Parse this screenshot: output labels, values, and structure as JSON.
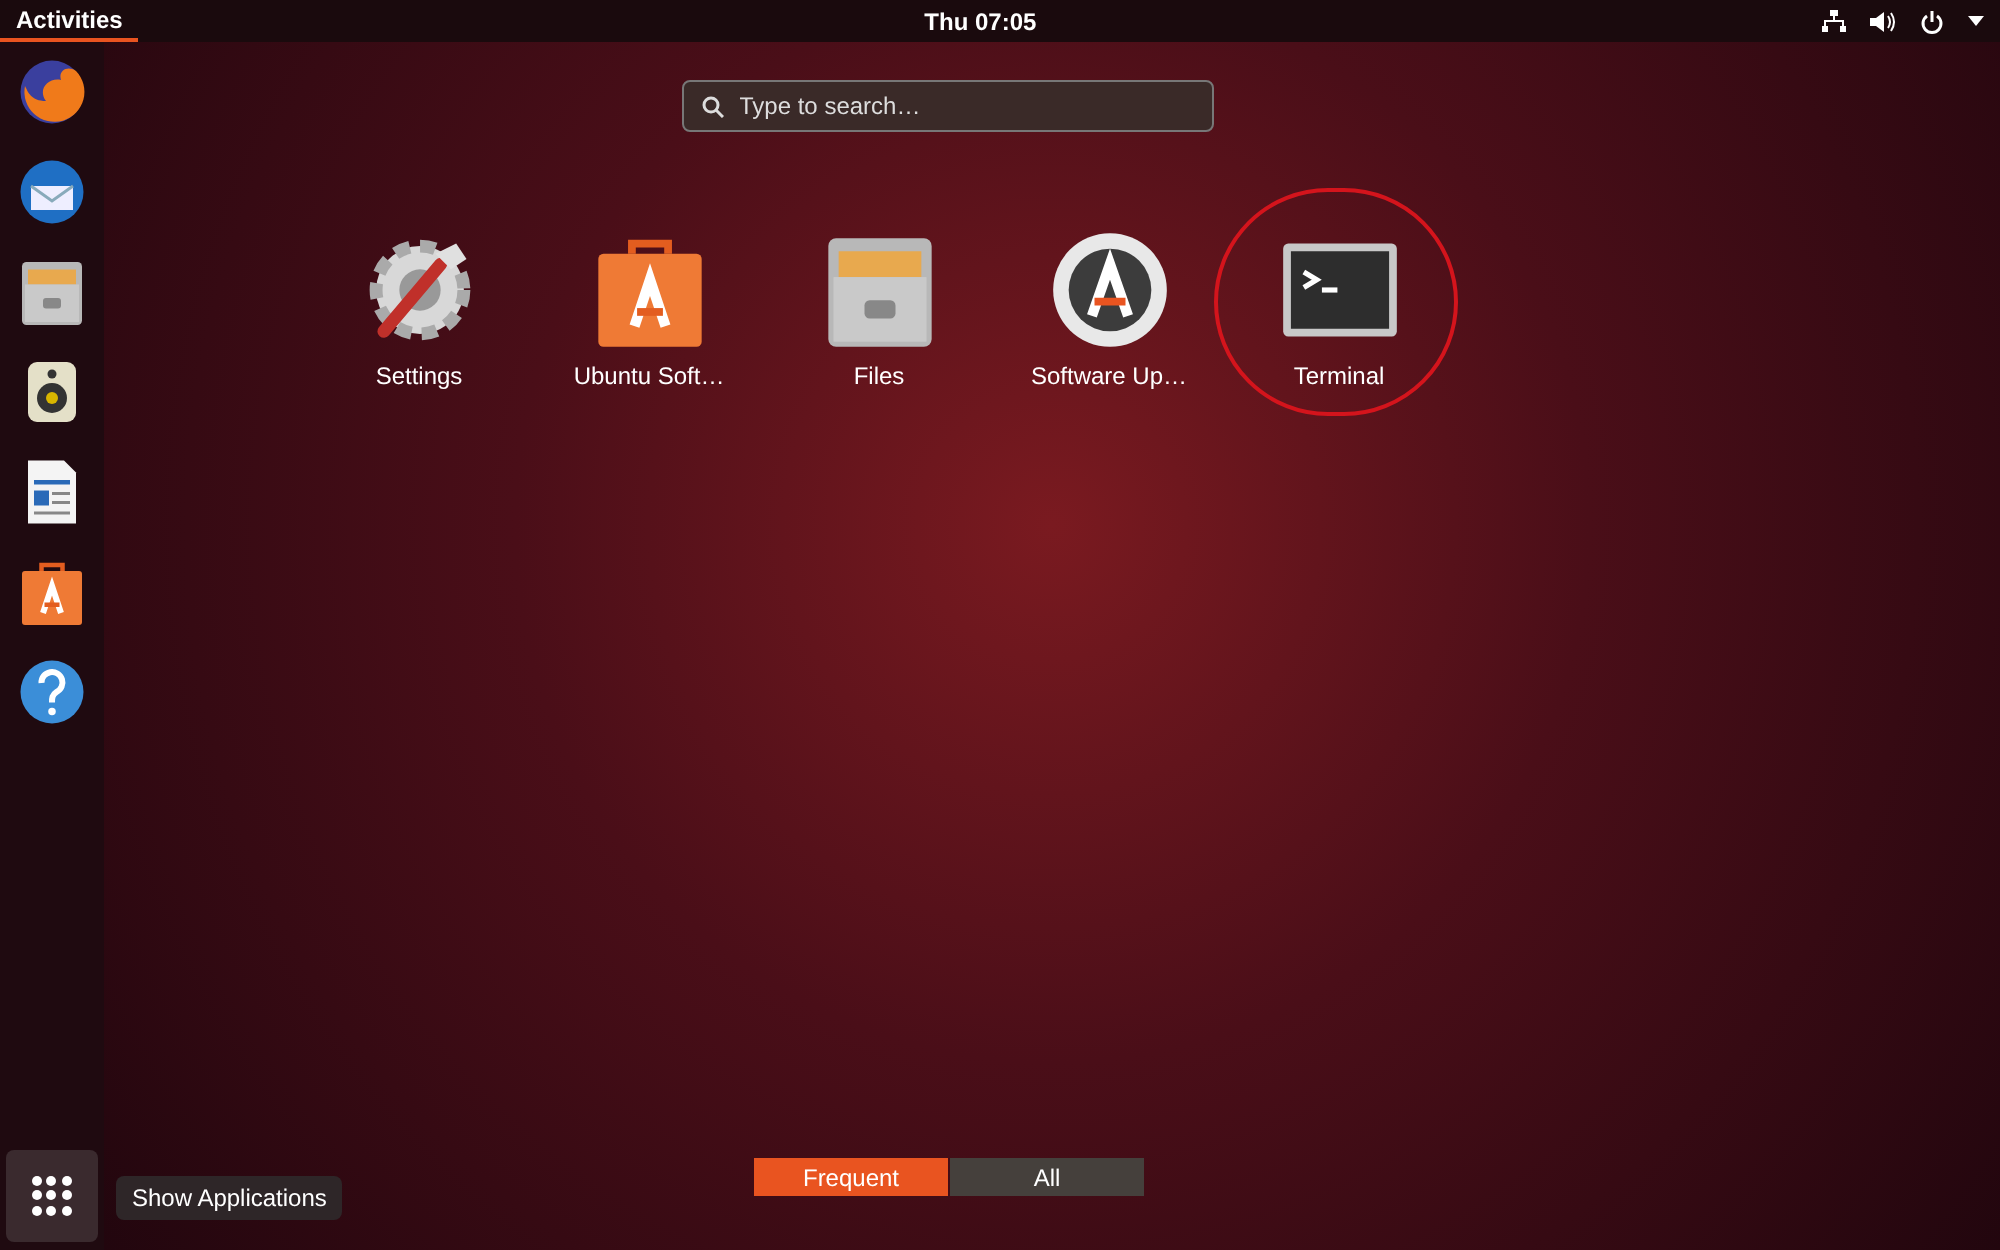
{
  "top_bar": {
    "activities": {
      "label": "Activities",
      "selected": true
    },
    "clock": "Thu 07:05"
  },
  "dock": {
    "items": [
      {
        "kind": "firefox"
      },
      {
        "kind": "mail"
      },
      {
        "kind": "files"
      },
      {
        "kind": "music"
      },
      {
        "kind": "writer"
      },
      {
        "kind": "store"
      },
      {
        "kind": "help"
      }
    ],
    "show_applications": {
      "tooltip": "Show Applications"
    }
  },
  "search": {
    "placeholder": "Type to search…"
  },
  "apps": [
    {
      "label": "Settings",
      "kind": "settings",
      "highlighted": false
    },
    {
      "label": "Ubuntu Soft…",
      "kind": "store",
      "highlighted": false
    },
    {
      "label": "Files",
      "kind": "files",
      "highlighted": false
    },
    {
      "label": "Software Up…",
      "kind": "updater",
      "highlighted": false
    },
    {
      "label": "Terminal",
      "kind": "terminal",
      "highlighted": true
    }
  ],
  "view_tabs": [
    {
      "label": "Frequent",
      "selected": true
    },
    {
      "label": "All",
      "selected": false
    }
  ]
}
